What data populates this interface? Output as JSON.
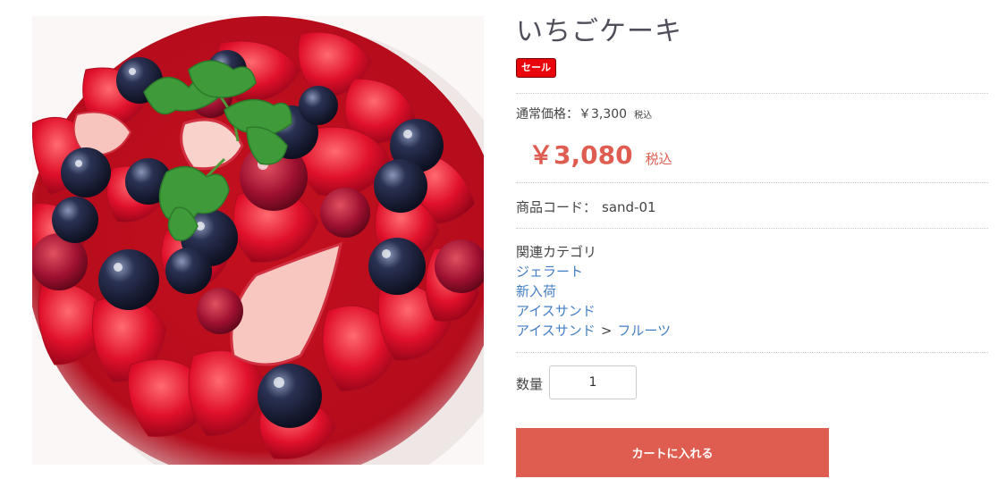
{
  "product": {
    "title": "いちごケーキ",
    "badge": "セール",
    "regular_price_label": "通常価格：￥3,300",
    "regular_price_tax": "税込",
    "sale_price": "￥3,080",
    "sale_price_tax": "税込",
    "code_label": "商品コード：",
    "code_value": "sand-01",
    "image_icon": "strawberry-berry-tart-photo"
  },
  "categories": {
    "heading": "関連カテゴリ",
    "links": [
      "ジェラート",
      "新入荷",
      "アイスサンド"
    ],
    "breadcrumb_parent": "アイスサンド",
    "breadcrumb_separator": ">",
    "breadcrumb_child": "フルーツ"
  },
  "cart": {
    "quantity_label": "数量",
    "quantity_value": "1",
    "add_to_cart_label": "カートに入れる"
  },
  "colors": {
    "accent": "#de5d50",
    "badge": "#e8060c",
    "link": "#437ec4"
  }
}
